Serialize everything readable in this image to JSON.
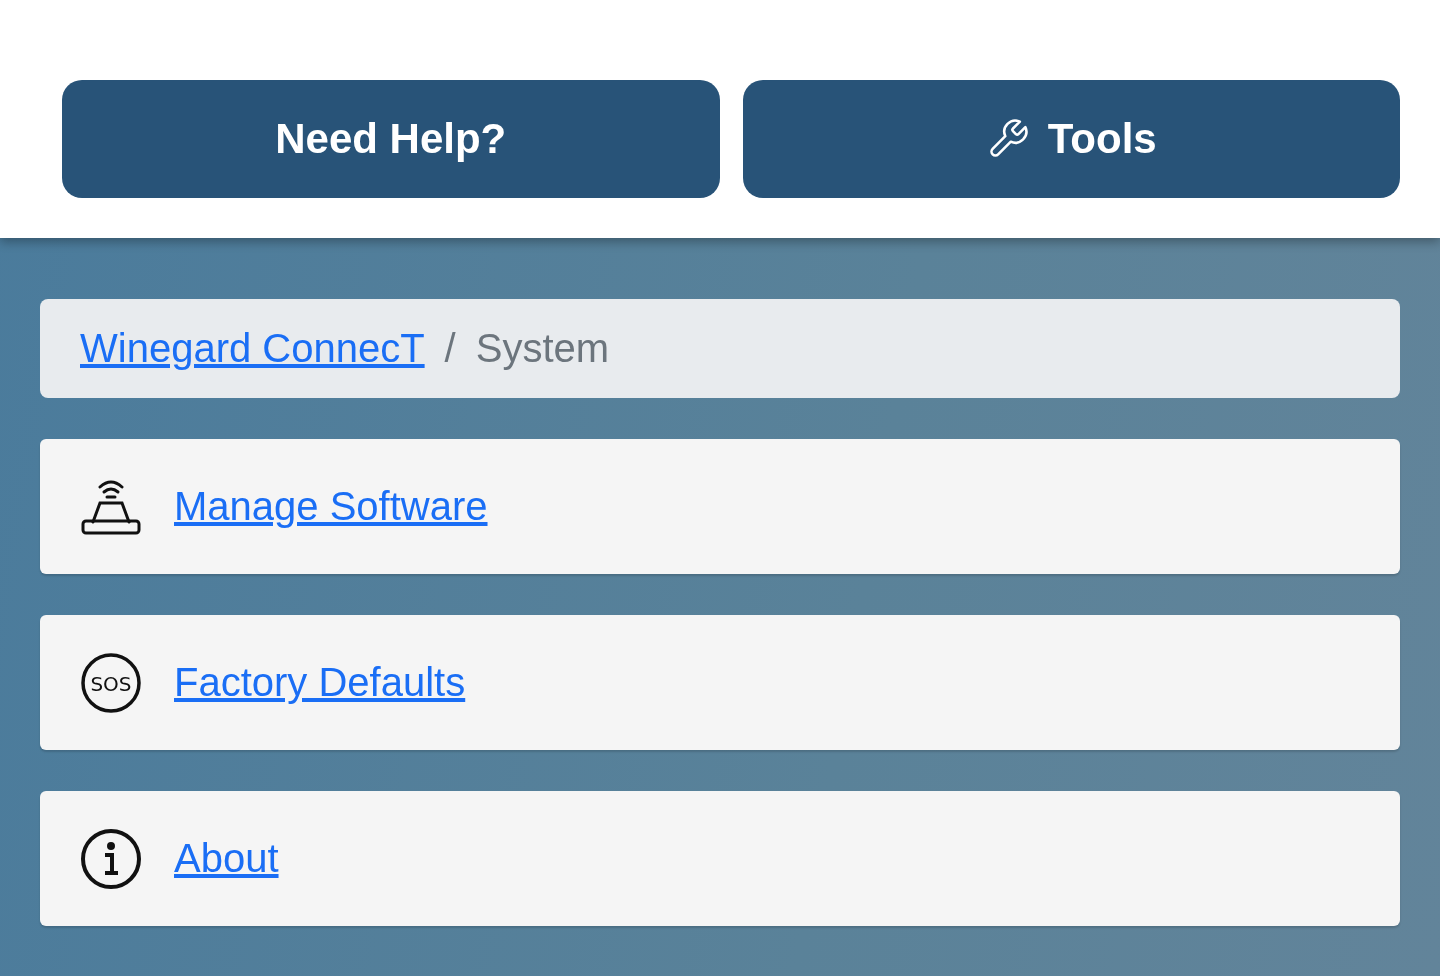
{
  "header": {
    "buttons": [
      {
        "label": "Need Help?",
        "kind": "help"
      },
      {
        "label": "Tools",
        "kind": "tools"
      }
    ]
  },
  "breadcrumb": {
    "items": [
      {
        "label": "Winegard ConnecT",
        "kind": "link"
      },
      {
        "label": "/",
        "kind": "separator"
      },
      {
        "label": "System",
        "kind": "current"
      }
    ]
  },
  "menu": [
    {
      "label": "Manage Software",
      "kind": "router"
    },
    {
      "label": "Factory Defaults",
      "kind": "sos",
      "icon_text": "SOS"
    },
    {
      "label": "About",
      "kind": "info"
    }
  ]
}
